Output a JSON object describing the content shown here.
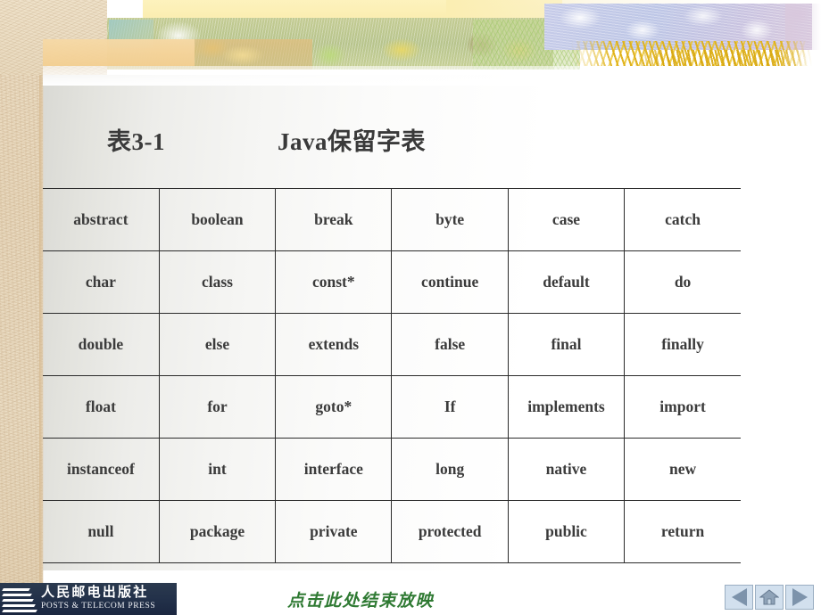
{
  "slide": {
    "title_label": "表3-1",
    "title_main": "Java保留字表"
  },
  "keyword_table": {
    "columns": 6,
    "rows": [
      [
        "abstract",
        "boolean",
        "break",
        "byte",
        "case",
        "catch"
      ],
      [
        "char",
        "class",
        "const*",
        "continue",
        "default",
        "do"
      ],
      [
        "double",
        "else",
        "extends",
        "false",
        "final",
        "finally"
      ],
      [
        "float",
        "for",
        "goto*",
        "If",
        "implements",
        "import"
      ],
      [
        "instanceof",
        "int",
        "interface",
        "long",
        "native",
        "new"
      ],
      [
        "null",
        "package",
        "private",
        "protected",
        "public",
        "return"
      ]
    ]
  },
  "footer": {
    "publisher_cn": "人民邮电出版社",
    "publisher_en": "POSTS & TELECOM PRESS",
    "end_show_label": "点击此处结束放映",
    "nav": {
      "back_icon": "triangle-left-icon",
      "home_icon": "home-icon",
      "forward_icon": "triangle-right-icon"
    }
  },
  "colors": {
    "text": "#3b3b3b",
    "table_border": "#2b2b2b",
    "link_green": "#2f7a33",
    "logo_navy": "#223049",
    "nav_button_fill": "#d2e0ee",
    "nav_glyph": "#7d93ab",
    "strip_tan": "#e8d8bd",
    "lavender": "#c2c8e6",
    "foliage_olive": "#bcc78e",
    "cream": "#fbeeb2",
    "wheat_gold": "#deb018"
  }
}
